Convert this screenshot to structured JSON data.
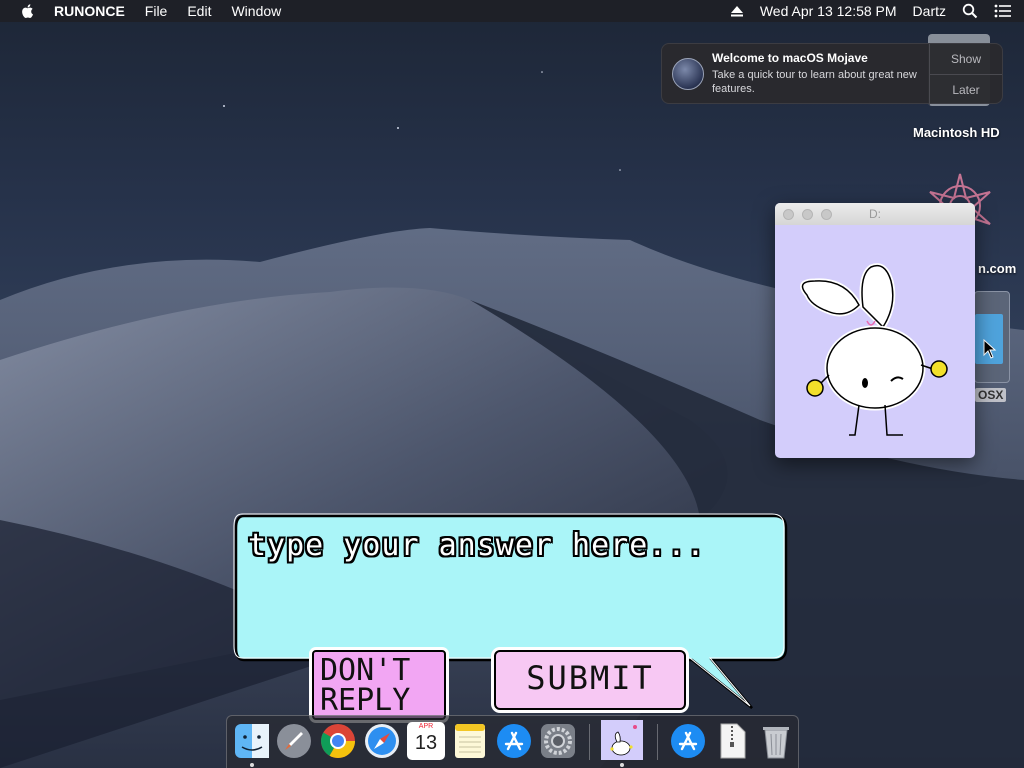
{
  "menubar": {
    "app_name": "RUNONCE",
    "menus": [
      "File",
      "Edit",
      "Window"
    ],
    "datetime": "Wed Apr 13  12:58 PM",
    "user": "Dartz"
  },
  "notification": {
    "title": "Welcome to macOS Mojave",
    "body": "Take a quick tour to learn about great new features.",
    "show_label": "Show",
    "later_label": "Later"
  },
  "desktop": {
    "hd_label": "Macintosh HD",
    "com_label": "n.com",
    "osx_label": "OSX"
  },
  "d_window": {
    "title": "D:"
  },
  "dialog": {
    "placeholder": "type your answer here...",
    "dont_reply_label": "DON'T REPLY",
    "submit_label": "SUBMIT"
  },
  "dock": {
    "items": [
      "finder",
      "launchpad",
      "chrome",
      "safari",
      "calendar",
      "notes",
      "app-store",
      "system-preferences",
      "runonce",
      "app-store-folder",
      "archive",
      "trash"
    ],
    "calendar_month": "APR",
    "calendar_day": "13"
  }
}
